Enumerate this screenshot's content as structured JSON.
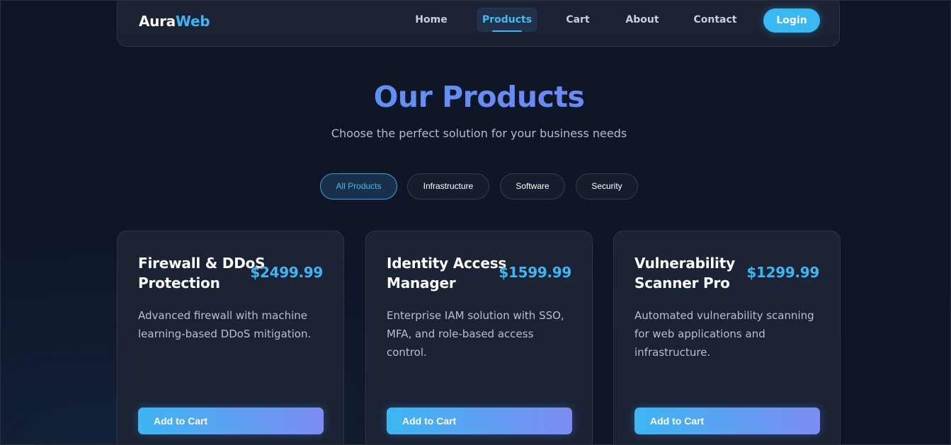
{
  "brand": {
    "part1": "Aura",
    "part2": "Web"
  },
  "nav": {
    "items": [
      {
        "label": "Home"
      },
      {
        "label": "Products"
      },
      {
        "label": "Cart"
      },
      {
        "label": "About"
      },
      {
        "label": "Contact"
      }
    ],
    "active": "Products",
    "login_label": "Login"
  },
  "header": {
    "title": "Our Products",
    "subtitle": "Choose the perfect solution for your business needs"
  },
  "filters": {
    "items": [
      {
        "label": "All Products"
      },
      {
        "label": "Infrastructure"
      },
      {
        "label": "Software"
      },
      {
        "label": "Security"
      }
    ],
    "active": "All Products"
  },
  "products": [
    {
      "title": "Firewall & DDoS Protection",
      "price": "$2499.99",
      "description": "Advanced firewall with machine learning-based DDoS mitigation.",
      "button": "Add to Cart"
    },
    {
      "title": "Identity Access Manager",
      "price": "$1599.99",
      "description": "Enterprise IAM solution with SSO, MFA, and role-based access control.",
      "button": "Add to Cart"
    },
    {
      "title": "Vulnerability Scanner Pro",
      "price": "$1299.99",
      "description": "Automated vulnerability scanning for web applications and infrastructure.",
      "button": "Add to Cart"
    }
  ],
  "colors": {
    "accent": "#3fb6f2",
    "gradient_end": "#7d8cf2",
    "background": "#0e1627",
    "card": "#1c2334"
  }
}
